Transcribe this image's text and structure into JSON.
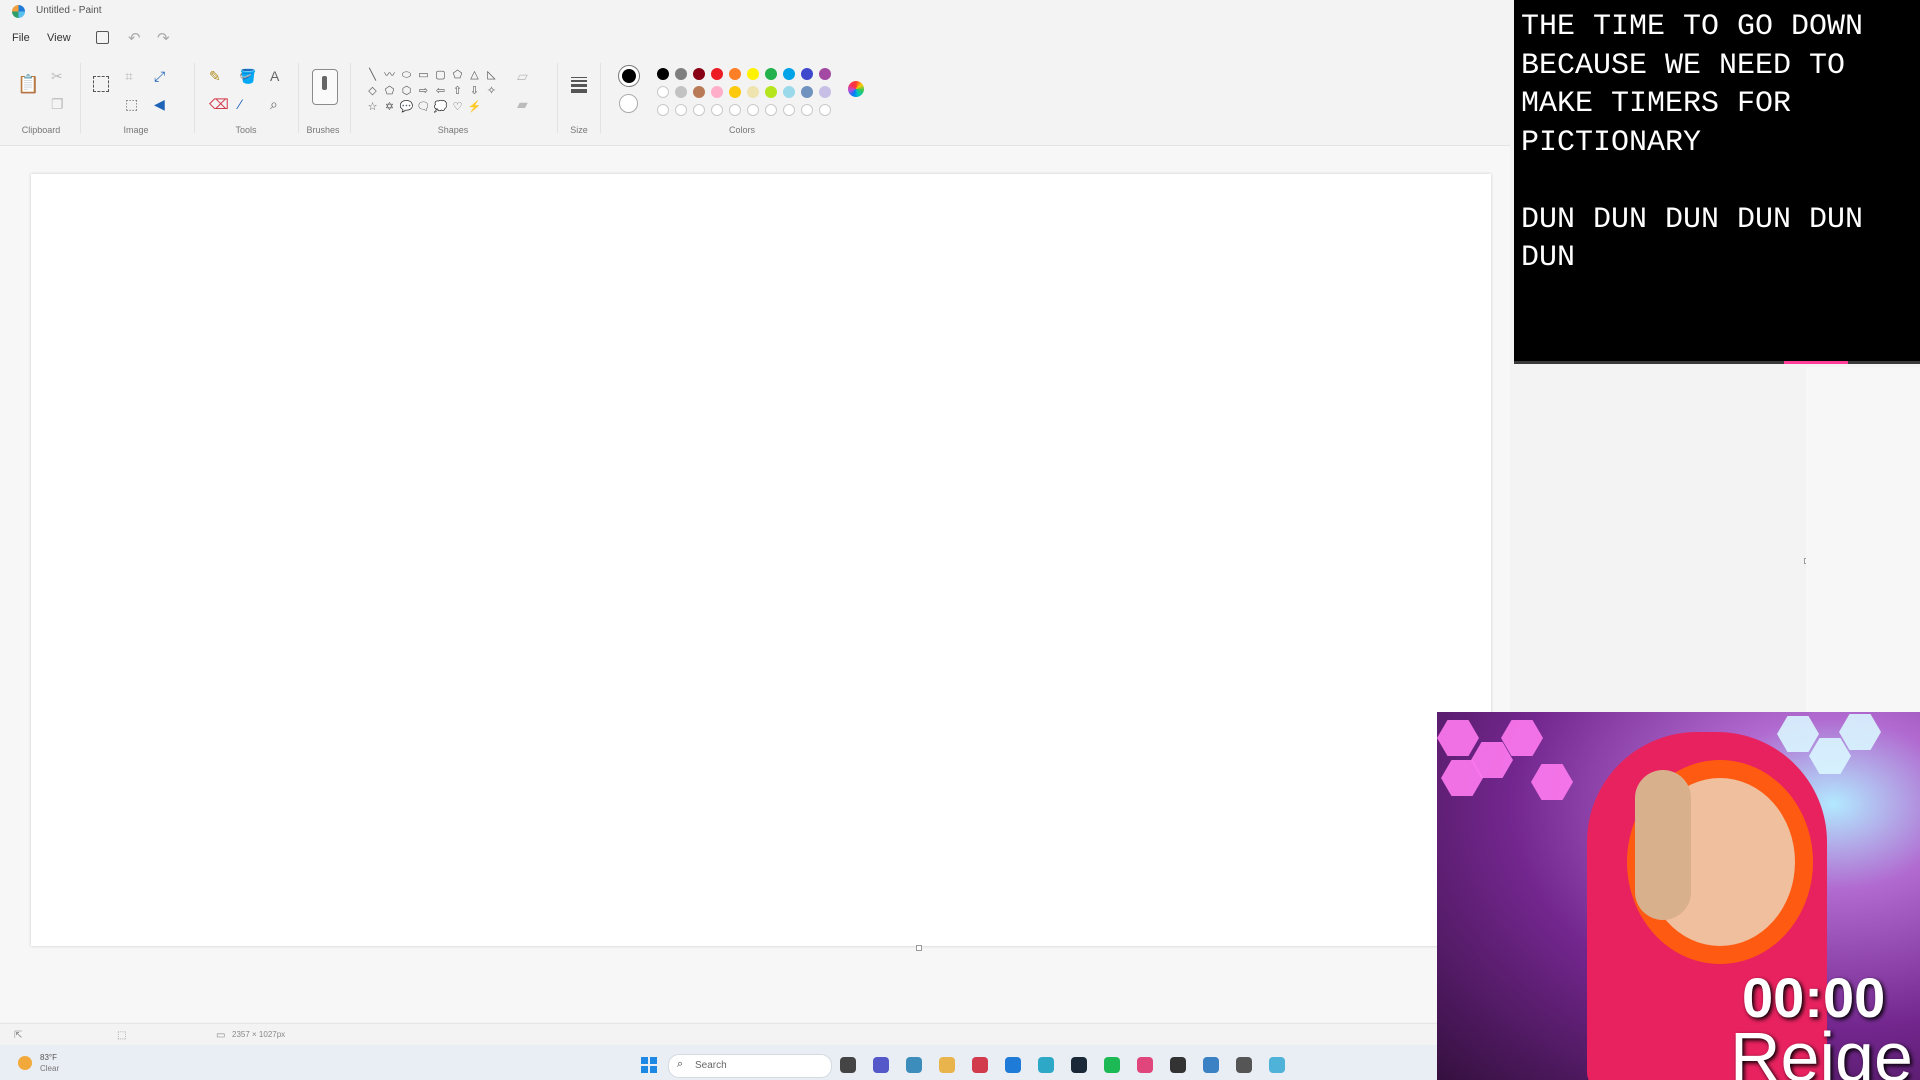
{
  "window": {
    "title": "Untitled - Paint"
  },
  "menu": {
    "file": "File",
    "view": "View"
  },
  "ribbon": {
    "groups": {
      "clipboard": "Clipboard",
      "image": "Image",
      "tools": "Tools",
      "brushes": "Brushes",
      "shapes": "Shapes",
      "size": "Size",
      "colors": "Colors"
    },
    "shapes": [
      "╲",
      "〰",
      "⬭",
      "▭",
      "▢",
      "⬠",
      "△",
      "◺",
      "◇",
      "⬠",
      "⬡",
      "⇨",
      "⇦",
      "⇧",
      "⇩",
      "✧",
      "☆",
      "✡",
      "💬",
      "🗨",
      "💭",
      "♡",
      "⚡",
      ""
    ],
    "colors": {
      "primary": "#000000",
      "secondary": "#ffffff",
      "palette_row1": [
        "#000000",
        "#7f7f7f",
        "#880015",
        "#ed1c24",
        "#ff7f27",
        "#fff200",
        "#22b14c",
        "#00a2e8",
        "#3f48cc",
        "#a349a4"
      ],
      "palette_row2": [
        "#ffffff",
        "#c3c3c3",
        "#b97a57",
        "#ffaec9",
        "#ffc90e",
        "#efe4b0",
        "#b5e61d",
        "#99d9ea",
        "#7092be",
        "#c8bfe7"
      ],
      "palette_row3": [
        "",
        "",
        "",
        "",
        "",
        "",
        "",
        "",
        "",
        ""
      ]
    }
  },
  "status": {
    "canvas_size": "2357 × 1027px"
  },
  "taskbar": {
    "weather_temp": "83°F",
    "weather_condition": "Clear",
    "search_placeholder": "Search",
    "apps": [
      "#444444",
      "#5558c9",
      "#3c8dbc",
      "#e9b44c",
      "#d23b4c",
      "#1f7bd8",
      "#2ea8c7",
      "#1b2838",
      "#1db954",
      "#e0467c",
      "#333333",
      "#3b82c4",
      "#555555",
      "#4fb3d9"
    ]
  },
  "overlay": {
    "lines": [
      "THE TIME TO GO DOWN",
      "BECAUSE WE NEED TO",
      "MAKE TIMERS FOR",
      "PICTIONARY",
      "",
      "DUN DUN DUN DUN DUN",
      "DUN"
    ]
  },
  "webcam": {
    "timer": "00:00",
    "name": "Reige"
  }
}
